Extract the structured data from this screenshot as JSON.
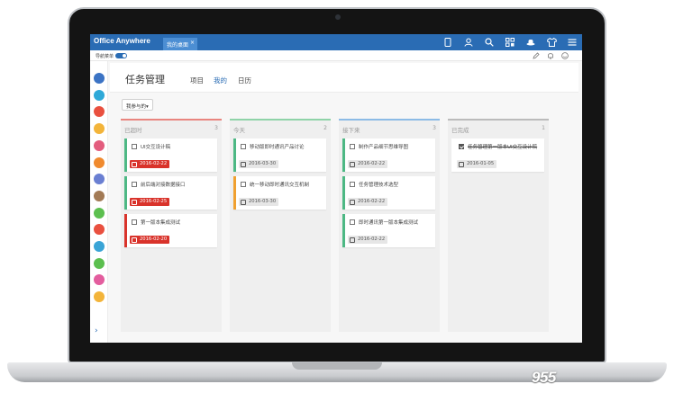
{
  "app": {
    "brand": "Office Anywhere",
    "tab_label": "我的桌面",
    "tab_close": "×",
    "nav_label": "导航菜单"
  },
  "colors": {
    "primary_blue": "#2a6cb4",
    "overdue_red": "#d9332b",
    "today_green": "#4db884",
    "future_orange": "#f0a030",
    "done_grey": "#aaaaaa"
  },
  "top_icons": [
    "mobile-icon",
    "user-icon",
    "search-icon",
    "grid-icon",
    "hat-icon",
    "shirt-icon",
    "menu-icon"
  ],
  "sub_icons": [
    "edit-icon",
    "bell-icon",
    "smiley-icon"
  ],
  "sidebar_icon_colors": [
    "#3b73c4",
    "#2fa9d8",
    "#e9503f",
    "#f3b43a",
    "#e35d7e",
    "#f08a2e",
    "#6a7fd2",
    "#a27a55",
    "#5cbf4f",
    "#e9503f",
    "#3aa4d6",
    "#5cbf4f",
    "#e35d9e",
    "#f3b43a"
  ],
  "page": {
    "title": "任务管理",
    "tabs": [
      {
        "label": "项目",
        "active": false
      },
      {
        "label": "我的",
        "active": true
      },
      {
        "label": "日历",
        "active": false
      }
    ],
    "filter": "我参与的▾"
  },
  "columns": [
    {
      "title": "已超时",
      "count": "3",
      "accent": "#e9857f",
      "cards": [
        {
          "title": "UI交互设计稿",
          "date": "2016-02-22",
          "style": "red",
          "strip": "#4db884",
          "done": false
        },
        {
          "title": "前后端对接数据接口",
          "date": "2016-02-25",
          "style": "red",
          "strip": "#4db884",
          "done": false
        },
        {
          "title": "第一版本集成测试",
          "date": "2016-02-20",
          "style": "red",
          "strip": "#d9332b",
          "done": false
        }
      ]
    },
    {
      "title": "今天",
      "count": "2",
      "accent": "#8fd3a8",
      "cards": [
        {
          "title": "移动版即时通讯产品讨论",
          "date": "2016-03-30",
          "style": "grey",
          "strip": "#4db884",
          "done": false
        },
        {
          "title": "统一移动即时通讯交互机制",
          "date": "2016-03-30",
          "style": "grey",
          "strip": "#f0a030",
          "done": false
        }
      ]
    },
    {
      "title": "接下来",
      "count": "3",
      "accent": "#8cbbe6",
      "cards": [
        {
          "title": "制作产品细节思维导图",
          "date": "2016-02-22",
          "style": "grey",
          "strip": "#4db884",
          "done": false
        },
        {
          "title": "任务管理技术选型",
          "date": "2016-02-22",
          "style": "grey",
          "strip": "#4db884",
          "done": false
        },
        {
          "title": "即时通讯第一版本集成测试",
          "date": "2016-02-22",
          "style": "grey",
          "strip": "#4db884",
          "done": false
        }
      ]
    },
    {
      "title": "已完成",
      "count": "1",
      "accent": "#bbbbbb",
      "cards": [
        {
          "title": "任务管理第一版本UI交互设计稿",
          "date": "2016-01-05",
          "style": "grey",
          "strip": "#ffffff",
          "done": true
        }
      ]
    }
  ],
  "watermark": "955"
}
